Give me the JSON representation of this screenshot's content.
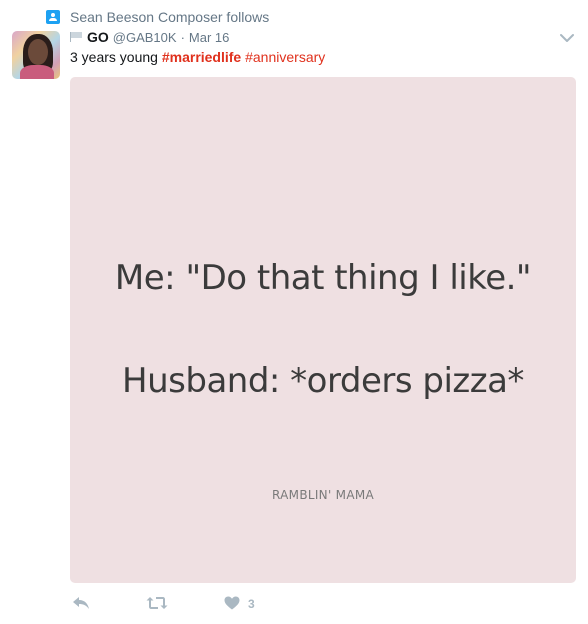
{
  "context": {
    "icon": "person-follow-icon",
    "text": "Sean Beeson Composer follows"
  },
  "tweet": {
    "display_name": "GO",
    "handle": "@GAB10K",
    "separator": "·",
    "date": "Mar 16",
    "text_plain": "3 years young",
    "hashtag_1": "#marriedlife",
    "hashtag_2": "#anniversary",
    "hashtag_color": "#e0311d"
  },
  "media": {
    "line1": "Me: \"Do that thing I like.\"",
    "line2": "Husband: *orders pizza*",
    "watermark": "RAMBLIN' MAMA",
    "background": "#efe0e2"
  },
  "actions": {
    "reply_icon": "reply-icon",
    "retweet_icon": "retweet-icon",
    "like_icon": "heart-icon",
    "like_count": "3"
  }
}
